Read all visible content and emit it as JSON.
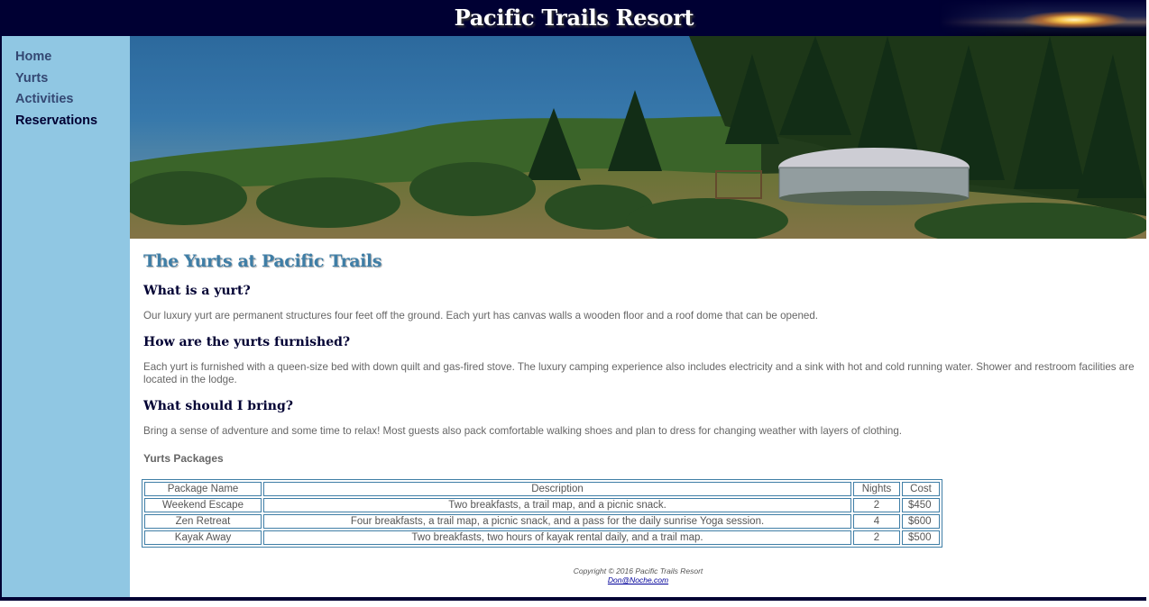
{
  "header": {
    "title": "Pacific Trails Resort"
  },
  "nav": {
    "items": [
      {
        "label": "Home"
      },
      {
        "label": "Yurts"
      },
      {
        "label": "Activities"
      },
      {
        "label": "Reservations"
      }
    ]
  },
  "main": {
    "heading": "The Yurts at Pacific Trails",
    "sections": [
      {
        "question": "What is a yurt?",
        "answer": "Our luxury yurt are permanent structures four feet off the ground. Each yurt has canvas walls a wooden floor and a roof dome that can be opened."
      },
      {
        "question": "How are the yurts furnished?",
        "answer": "Each yurt is furnished with a queen-size bed with down quilt and gas-fired stove. The luxury camping experience also includes electricity and a sink with hot and cold running water. Shower and restroom facilities are located in the lodge."
      },
      {
        "question": "What should I bring?",
        "answer": "Bring a sense of adventure and some time to relax! Most guests also pack comfortable walking shoes and plan to dress for changing weather with layers of clothing."
      }
    ],
    "packages": {
      "caption": "Yurts Packages",
      "headers": [
        "Package Name",
        "Description",
        "Nights",
        "Cost"
      ],
      "rows": [
        [
          "Weekend Escape",
          "Two breakfasts, a trail map, and a picnic snack.",
          "2",
          "$450"
        ],
        [
          "Zen Retreat",
          "Four breakfasts, a trail map, a picnic snack, and a pass for the daily sunrise Yoga session.",
          "4",
          "$600"
        ],
        [
          "Kayak Away",
          "Two breakfasts, two hours of kayak rental daily, and a trail map.",
          "2",
          "$500"
        ]
      ]
    }
  },
  "footer": {
    "copyright": "Copyright © 2016 Pacific Trails Resort",
    "email": "Don@Noche.com"
  },
  "colors": {
    "header_bg": "#000033",
    "nav_bg": "#90c7e3",
    "heading": "#3f7ea6",
    "subheading": "#000033",
    "body_text": "#666666"
  },
  "hero": {
    "image": "yurt-on-coastal-hillside"
  }
}
